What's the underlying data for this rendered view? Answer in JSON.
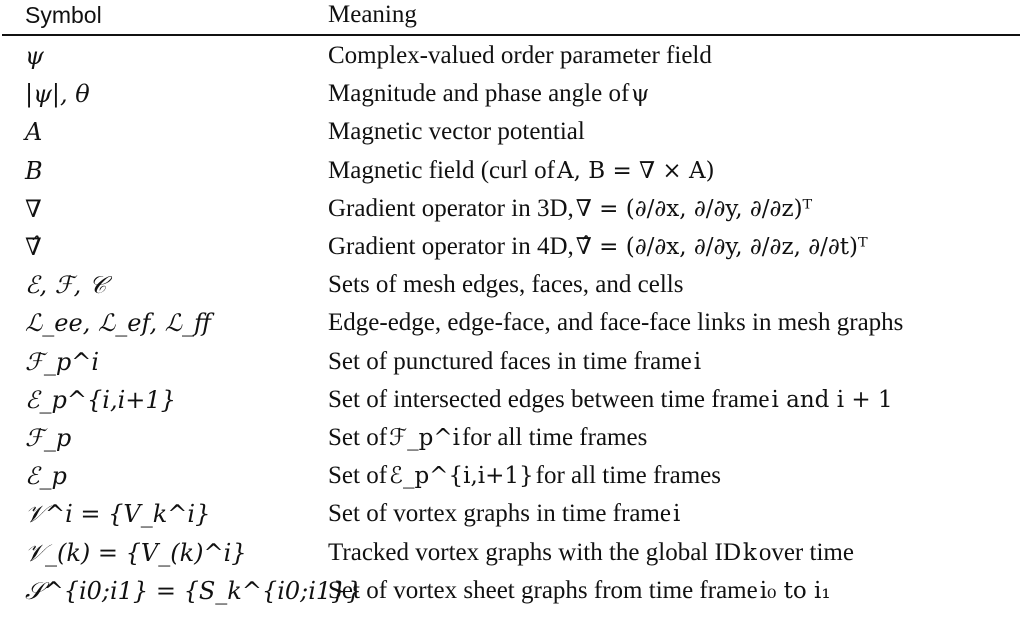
{
  "header": {
    "symbol": "Symbol",
    "meaning": "Meaning"
  },
  "rows": [
    {
      "symbol": "ψ",
      "meaning": "Complex-valued order parameter field"
    },
    {
      "symbol": "|ψ|, θ",
      "meaning": "Magnitude and phase angle of",
      "meaning_math": "ψ"
    },
    {
      "symbol": "A",
      "meaning": "Magnetic vector potential"
    },
    {
      "symbol": "B",
      "meaning": "Magnetic field (curl of",
      "meaning_math": "A, B = ∇ × A)"
    },
    {
      "symbol": "∇",
      "meaning": "Gradient operator in 3D,",
      "meaning_math": "∇ = (∂/∂x, ∂/∂y, ∂/∂z)ᵀ"
    },
    {
      "symbol": "∇̂",
      "meaning": "Gradient operator in 4D,",
      "meaning_math": "∇̂ = (∂/∂x, ∂/∂y, ∂/∂z, ∂/∂t)ᵀ"
    },
    {
      "symbol": "ℰ, ℱ, 𝒞",
      "meaning": "Sets of mesh edges, faces, and cells"
    },
    {
      "symbol": "ℒ_ee, ℒ_ef, ℒ_ff",
      "meaning": "Edge-edge, edge-face, and face-face links in mesh graphs"
    },
    {
      "symbol": "ℱ_p^i",
      "meaning": "Set of punctured faces in time frame",
      "meaning_math": "i"
    },
    {
      "symbol": "ℰ_p^{i,i+1}",
      "meaning": "Set of intersected edges between time frame",
      "meaning_math": "i and i + 1"
    },
    {
      "symbol": "ℱ_p",
      "meaning": "Set of",
      "meaning_math": "ℱ_p^i",
      "meaning_tail": "for all time frames"
    },
    {
      "symbol": "ℰ_p",
      "meaning": "Set of",
      "meaning_math": "ℰ_p^{i,i+1}",
      "meaning_tail": "for all time frames"
    },
    {
      "symbol": "𝒱^i = {V_k^i}",
      "meaning": "Set of vortex graphs in time frame",
      "meaning_math": "i"
    },
    {
      "symbol": "𝒱_(k) = {V_(k)^i}",
      "meaning": "Tracked vortex graphs with the global ID",
      "meaning_math": "k",
      "meaning_tail": "over time"
    },
    {
      "symbol": "𝒮^{i0;i1} = {S_k^{i0;i1}}",
      "meaning": "Set of vortex sheet graphs from time frame",
      "meaning_math": "i₀ to i₁"
    }
  ]
}
